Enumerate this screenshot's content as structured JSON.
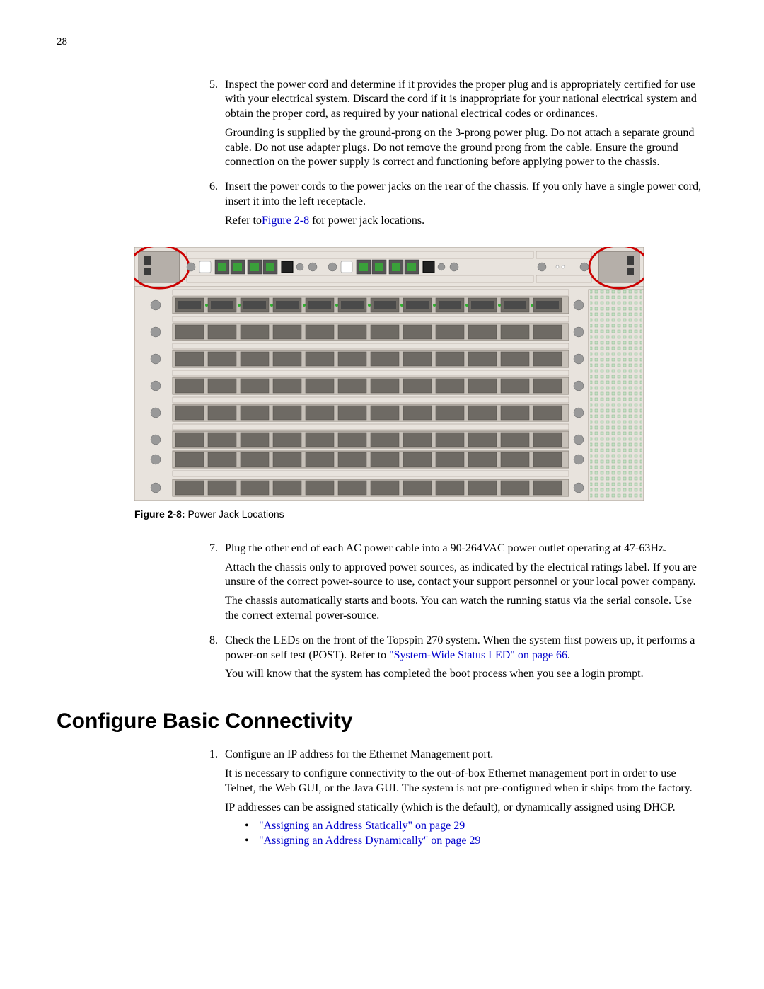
{
  "page_number": "28",
  "steps_a": [
    {
      "num": "5.",
      "paras": [
        "Inspect the power cord and determine if it provides the proper plug and is appropriately certified for use with your electrical system. Discard the cord if it is inappropriate for your national electrical system and obtain the proper cord, as required by your national electrical codes or ordinances.",
        "Grounding is supplied by the ground-prong on the 3-prong power plug. Do not attach a separate ground cable. Do not use adapter plugs. Do not remove the ground prong from the cable. Ensure the ground connection on the power supply is correct and functioning before applying power to the chassis."
      ]
    },
    {
      "num": "6.",
      "paras": [
        "Insert the power cords to the power jacks on the rear of the chassis. If you only have a single power cord, insert it into the left receptacle."
      ],
      "link_para": {
        "prefix": "Refer to",
        "link": "Figure 2-8",
        "suffix": " for power jack locations."
      }
    }
  ],
  "figure_caption": {
    "label": "Figure 2-8:",
    "text": " Power Jack Locations"
  },
  "steps_b": [
    {
      "num": "7.",
      "paras": [
        "Plug the other end of each AC power cable into a 90-264VAC power outlet operating at 47-63Hz.",
        "Attach the chassis only to approved power sources, as indicated by the electrical ratings label. If you are unsure of the correct power-source to use, contact your support personnel or your local power company.",
        "The chassis automatically starts and boots. You can watch the running status via the serial console. Use the correct external power-source."
      ]
    },
    {
      "num": "8.",
      "link_para": {
        "prefix": "Check the LEDs on the front of the Topspin 270 system. When the system first powers up, it performs a power-on self test (POST). Refer to ",
        "link": "\"System-Wide Status LED\" on page 66",
        "suffix": "."
      },
      "paras_after": [
        "You will know that the system has completed the boot process when you see a login prompt."
      ]
    }
  ],
  "section_heading": "Configure Basic Connectivity",
  "steps_c": [
    {
      "num": "1.",
      "paras": [
        "Configure an IP address for the Ethernet Management port.",
        "It is necessary to configure connectivity to the out-of-box Ethernet management port in order to use Telnet, the Web GUI, or the Java GUI. The system is not pre-configured when it ships from the factory.",
        "IP addresses can be assigned statically (which is the default), or dynamically assigned using DHCP."
      ],
      "bullets": [
        "\"Assigning an Address Statically\" on page 29",
        "\"Assigning an Address Dynamically\" on page 29"
      ]
    }
  ]
}
